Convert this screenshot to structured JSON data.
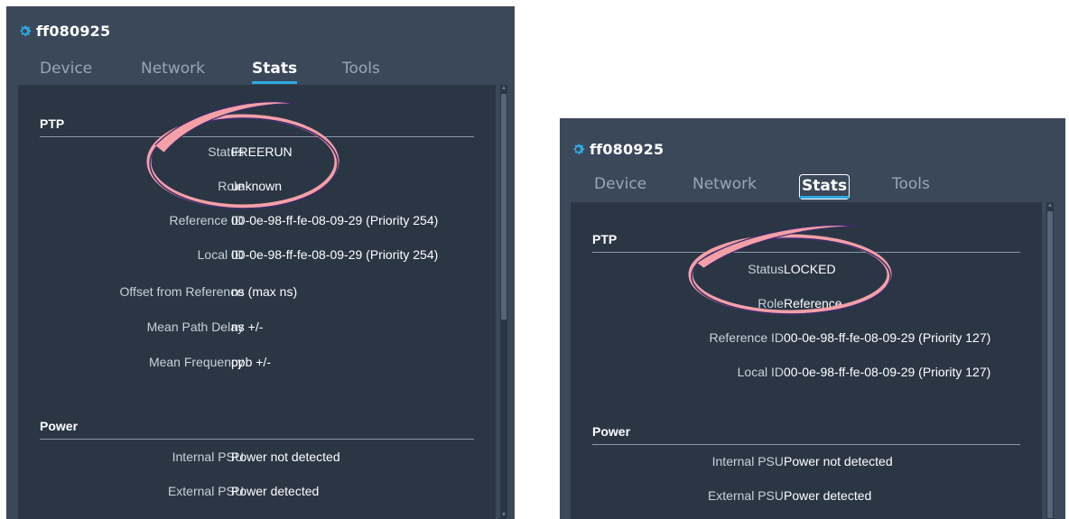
{
  "left": {
    "device_name": "ff080925",
    "tabs": [
      "Device",
      "Network",
      "Stats",
      "Tools"
    ],
    "ptp": {
      "title": "PTP",
      "rows": [
        {
          "label": "Status",
          "value": "FREERUN"
        },
        {
          "label": "Role",
          "value": "unknown"
        },
        {
          "label": "Reference ID",
          "value": "00-0e-98-ff-fe-08-09-29 (Priority 254)"
        },
        {
          "label": "Local ID",
          "value": "00-0e-98-ff-fe-08-09-29 (Priority 254)"
        },
        {
          "label": "Offset from Reference",
          "value": "ns (max ns)"
        },
        {
          "label": "Mean Path Delay",
          "value": "ns +/-"
        },
        {
          "label": "Mean Frequency",
          "value": "ppb +/-"
        }
      ]
    },
    "power": {
      "title": "Power",
      "rows": [
        {
          "label": "Internal PSU",
          "value": "Power not detected"
        },
        {
          "label": "External PSU",
          "value": "Power detected"
        }
      ]
    }
  },
  "right": {
    "device_name": "ff080925",
    "tabs": [
      "Device",
      "Network",
      "Stats",
      "Tools"
    ],
    "ptp": {
      "title": "PTP",
      "rows": [
        {
          "label": "Status",
          "value": "LOCKED"
        },
        {
          "label": "Role",
          "value": "Reference"
        },
        {
          "label": "Reference ID",
          "value": "00-0e-98-ff-fe-08-09-29 (Priority 127)"
        },
        {
          "label": "Local ID",
          "value": "00-0e-98-ff-fe-08-09-29 (Priority 127)"
        }
      ]
    },
    "power": {
      "title": "Power",
      "rows": [
        {
          "label": "Internal PSU",
          "value": "Power not detected"
        },
        {
          "label": "External PSU",
          "value": "Power detected"
        }
      ]
    }
  },
  "colors": {
    "panel_bg": "#3b4859",
    "content_bg": "#2b3645",
    "accent": "#2fa8e0",
    "highlight_ring": "#f4a0a6"
  },
  "icons": {
    "device": "gear-icon"
  }
}
